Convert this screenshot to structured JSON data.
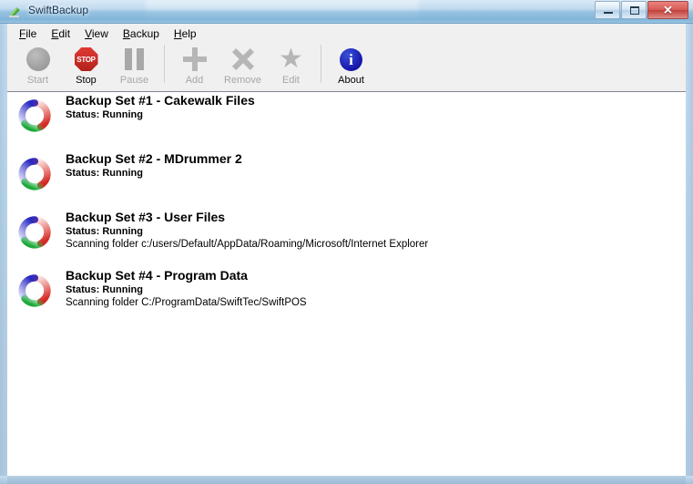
{
  "window": {
    "title": "SwiftBackup",
    "app_icon": "green-arrow-icon",
    "controls": {
      "minimize": "–",
      "maximize": "□",
      "close": "✕"
    }
  },
  "menubar": {
    "items": [
      {
        "label": "File",
        "accel": "F",
        "rest": "ile"
      },
      {
        "label": "Edit",
        "accel": "E",
        "rest": "dit"
      },
      {
        "label": "View",
        "accel": "V",
        "rest": "iew"
      },
      {
        "label": "Backup",
        "accel": "B",
        "rest": "ackup"
      },
      {
        "label": "Help",
        "accel": "H",
        "rest": "elp"
      }
    ]
  },
  "toolbar": {
    "buttons": [
      {
        "label": "Start",
        "icon": "grey-circle-icon",
        "enabled": false
      },
      {
        "label": "Stop",
        "icon": "stop-sign-icon",
        "enabled": true,
        "stop_text": "STOP"
      },
      {
        "label": "Pause",
        "icon": "pause-bars-icon",
        "enabled": false
      },
      {
        "label": "Add",
        "icon": "plus-icon",
        "enabled": false
      },
      {
        "label": "Remove",
        "icon": "x-cross-icon",
        "enabled": false
      },
      {
        "label": "Edit",
        "icon": "star-icon",
        "enabled": false,
        "glyph": "★"
      },
      {
        "label": "About",
        "icon": "info-circle-icon",
        "enabled": true,
        "glyph": "i"
      }
    ]
  },
  "backup_sets": [
    {
      "title": "Backup Set #1 - Cakewalk Files",
      "status": "Status: Running",
      "detail": "",
      "icon": "progress-spinner-icon"
    },
    {
      "title": "Backup Set #2 - MDrummer 2",
      "status": "Status: Running",
      "detail": "",
      "icon": "progress-spinner-icon"
    },
    {
      "title": "Backup Set #3 - User Files",
      "status": "Status: Running",
      "detail": "Scanning folder c:/users/Default/AppData/Roaming/Microsoft/Internet Explorer",
      "icon": "progress-spinner-icon"
    },
    {
      "title": "Backup Set #4 - Program Data",
      "status": "Status: Running",
      "detail": "Scanning folder C:/ProgramData/SwiftTec/SwiftPOS",
      "icon": "progress-spinner-icon"
    }
  ],
  "colors": {
    "stop_red": "#c8221d",
    "about_blue": "#1414a8",
    "spinner_blue": "#3b3bd0",
    "spinner_red": "#e03a33",
    "spinner_green": "#2fbf4a",
    "toolbar_bg": "#f0f0f0",
    "list_bg": "#ffffff",
    "close_button_red": "#c23f3b"
  }
}
